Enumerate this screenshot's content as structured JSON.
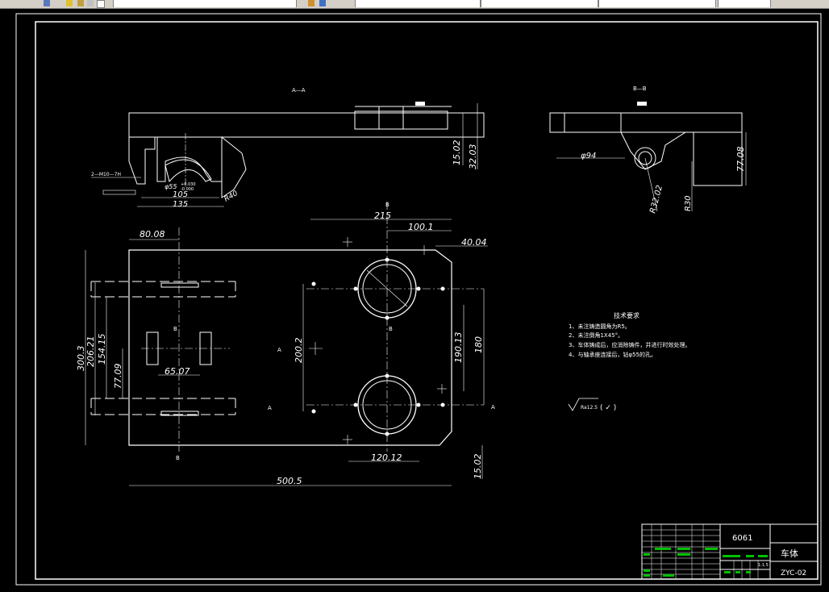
{
  "toolbar": {
    "segments": [
      "",
      "",
      "",
      "",
      "",
      "",
      ""
    ]
  },
  "colors": {
    "background": "#000000",
    "lines": "#ffffff",
    "green": "#00ff00",
    "hatch": "#ffffff"
  },
  "views": {
    "section_aa": "A—A",
    "section_bb": "B—B"
  },
  "section_labels": {
    "a": "A",
    "b": "B"
  },
  "dims_aa": {
    "d1": "15.02",
    "d2": "32.03",
    "d3": "105",
    "d4": "135",
    "d5": "φ55",
    "d6": "R40",
    "thread": "2—M10—7H",
    "tol_up": "+0.030",
    "tol_dn": "-0.000"
  },
  "dims_bb": {
    "d1": "φ94",
    "d2": "77.08",
    "d3": "R32.02",
    "d4": "R30"
  },
  "dims_top": {
    "d1": "80.08",
    "d2": "215",
    "d3": "100.1",
    "d4": "40.04",
    "d5": "300.3",
    "d6": "206.21",
    "d7": "154.15",
    "d8": "77.09",
    "d9": "65.07",
    "d10": "200.2",
    "d11": "190.13",
    "d12": "180",
    "d13": "120.12",
    "d14": "15.02",
    "d15": "500.5"
  },
  "tech": {
    "title": "技术要求",
    "lines": [
      "1、未注铸造圆角为R5。",
      "2、未注倒角1X45°。",
      "3、车体铸成后，应消除铸件，并进行时效处理。",
      "4、与轴承座连接后，钻φ55的孔。"
    ],
    "roughness": "Ra12.5",
    "roughness_suffix": "( ✓ )"
  },
  "title_block": {
    "material": "6061",
    "part_name": "车体",
    "drawing_no": "ZYC-02",
    "scale": "1:1.5"
  }
}
